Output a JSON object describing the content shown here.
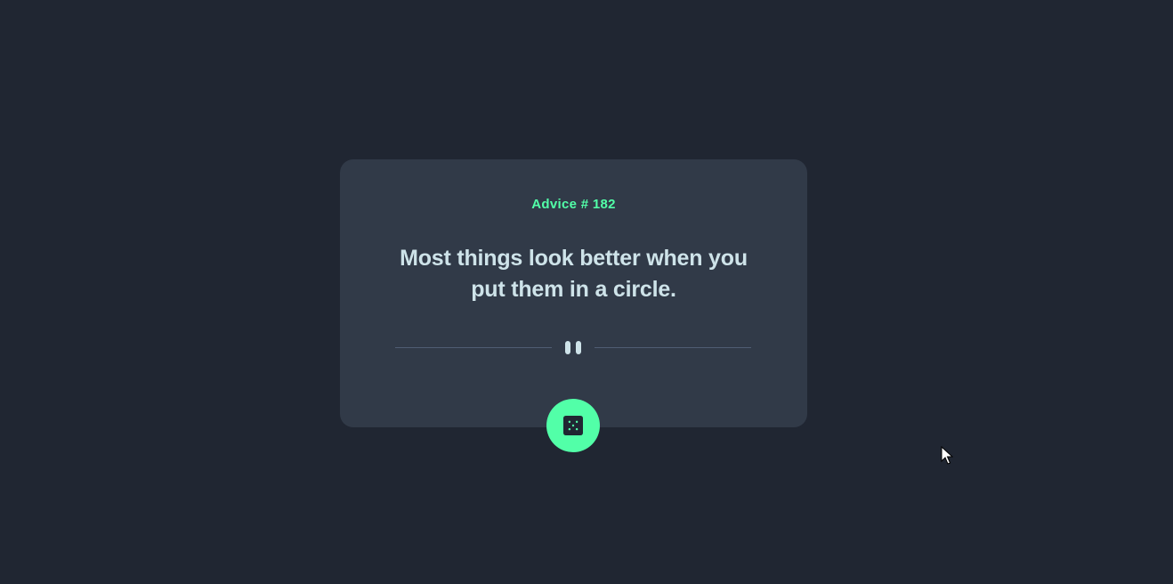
{
  "advice": {
    "id_label": "Advice # 182",
    "text": "Most things look better when you put them in a circle."
  },
  "divider": {
    "icon": "pause-icon"
  },
  "actions": {
    "roll_icon": "dice-icon"
  },
  "colors": {
    "background": "#202632",
    "card": "#313a48",
    "accent": "#52ffa8",
    "text": "#cee3e9",
    "divider": "#4f5d74"
  }
}
